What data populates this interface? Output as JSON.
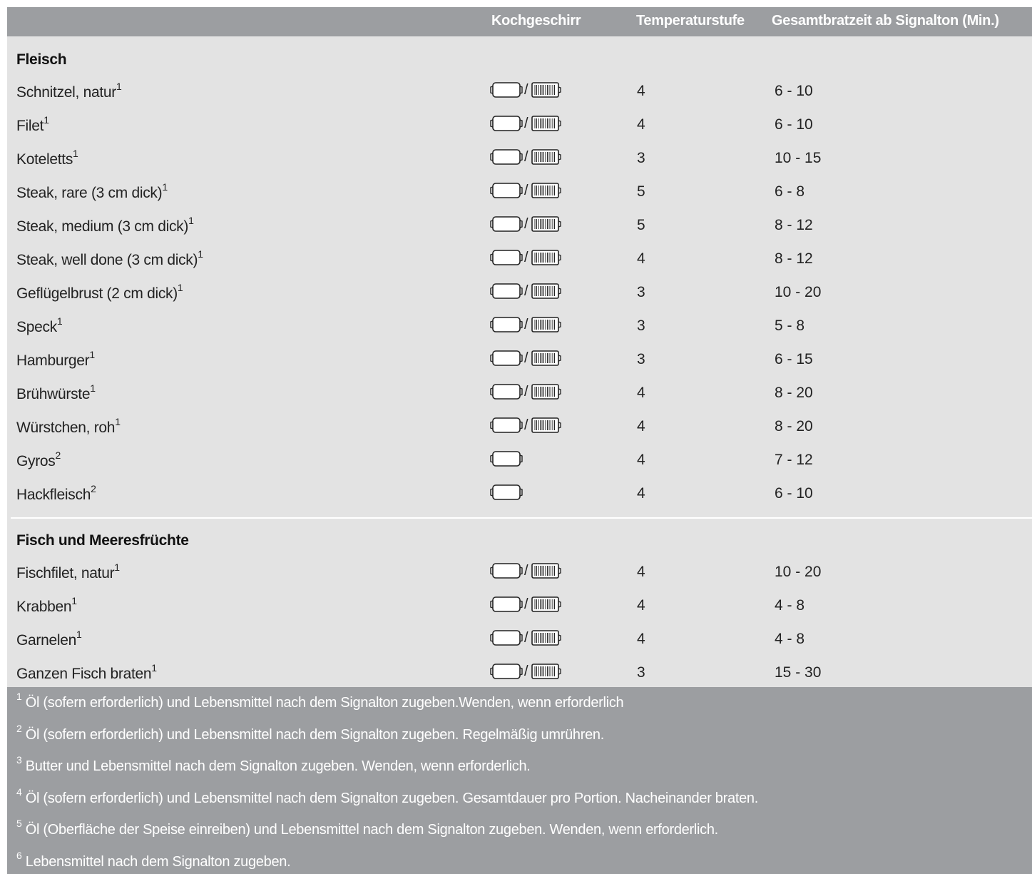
{
  "header": {
    "col_cookware": "Kochgeschirr",
    "col_temp": "Temperaturstufe",
    "col_time": "Gesamtbratzeit ab Signalton (Min.)"
  },
  "sections": [
    {
      "title": "Fleisch",
      "rows": [
        {
          "name": "Schnitzel, natur",
          "sup": "1",
          "cookware": [
            "pan-icon",
            "grill-plate-icon"
          ],
          "temp": "4",
          "time": "6 - 10"
        },
        {
          "name": "Filet",
          "sup": "1",
          "cookware": [
            "pan-icon",
            "grill-plate-icon"
          ],
          "temp": "4",
          "time": "6 - 10"
        },
        {
          "name": "Koteletts",
          "sup": "1",
          "cookware": [
            "pan-icon",
            "grill-plate-icon"
          ],
          "temp": "3",
          "time": "10 - 15"
        },
        {
          "name": "Steak, rare (3 cm dick)",
          "sup": "1",
          "cookware": [
            "pan-icon",
            "grill-plate-icon"
          ],
          "temp": "5",
          "time": "6 - 8"
        },
        {
          "name": "Steak, medium (3 cm dick)",
          "sup": "1",
          "cookware": [
            "pan-icon",
            "grill-plate-icon"
          ],
          "temp": "5",
          "time": "8 - 12"
        },
        {
          "name": "Steak, well done (3 cm dick)",
          "sup": "1",
          "cookware": [
            "pan-icon",
            "grill-plate-icon"
          ],
          "temp": "4",
          "time": "8 - 12"
        },
        {
          "name": "Geflügelbrust (2 cm dick)",
          "sup": "1",
          "cookware": [
            "pan-icon",
            "grill-plate-icon"
          ],
          "temp": "3",
          "time": "10 - 20"
        },
        {
          "name": "Speck",
          "sup": "1",
          "cookware": [
            "pan-icon",
            "grill-plate-icon"
          ],
          "temp": "3",
          "time": "5 - 8"
        },
        {
          "name": "Hamburger",
          "sup": "1",
          "cookware": [
            "pan-icon",
            "grill-plate-icon"
          ],
          "temp": "3",
          "time": "6 - 15"
        },
        {
          "name": "Brühwürste",
          "sup": "1",
          "cookware": [
            "pan-icon",
            "grill-plate-icon"
          ],
          "temp": "4",
          "time": "8 - 20"
        },
        {
          "name": "Würstchen, roh",
          "sup": "1",
          "cookware": [
            "pan-icon",
            "grill-plate-icon"
          ],
          "temp": "4",
          "time": "8 - 20"
        },
        {
          "name": "Gyros",
          "sup": "2",
          "cookware": [
            "pan-icon"
          ],
          "temp": "4",
          "time": "7 - 12"
        },
        {
          "name": "Hackfleisch",
          "sup": "2",
          "cookware": [
            "pan-icon"
          ],
          "temp": "4",
          "time": "6 - 10"
        }
      ]
    },
    {
      "title": "Fisch und Meeresfrüchte",
      "rows": [
        {
          "name": "Fischfilet, natur",
          "sup": "1",
          "cookware": [
            "pan-icon",
            "grill-plate-icon"
          ],
          "temp": "4",
          "time": "10 - 20"
        },
        {
          "name": "Krabben",
          "sup": "1",
          "cookware": [
            "pan-icon",
            "grill-plate-icon"
          ],
          "temp": "4",
          "time": "4 - 8"
        },
        {
          "name": "Garnelen",
          "sup": "1",
          "cookware": [
            "pan-icon",
            "grill-plate-icon"
          ],
          "temp": "4",
          "time": "4 - 8"
        },
        {
          "name": "Ganzen Fisch braten",
          "sup": "1",
          "cookware": [
            "pan-icon",
            "grill-plate-icon"
          ],
          "temp": "3",
          "time": "15 - 30"
        }
      ]
    }
  ],
  "separator": "/",
  "footnotes": [
    {
      "num": "1",
      "text": " Öl (sofern erforderlich) und Lebensmittel nach dem Signalton zugeben.Wenden, wenn erforderlich"
    },
    {
      "num": "2",
      "text": " Öl (sofern erforderlich) und Lebensmittel nach dem Signalton zugeben. Regelmäßig umrühren."
    },
    {
      "num": "3",
      "text": " Butter und Lebensmittel nach dem Signalton zugeben. Wenden, wenn erforderlich."
    },
    {
      "num": "4",
      "text": " Öl (sofern erforderlich) und Lebensmittel nach dem Signalton zugeben. Gesamtdauer pro Portion. Nacheinander braten."
    },
    {
      "num": "5",
      "text": " Öl (Oberfläche der Speise einreiben) und Lebensmittel nach dem Signalton zugeben. Wenden, wenn erforderlich."
    },
    {
      "num": "6",
      "text": " Lebensmittel nach dem Signalton zugeben."
    }
  ]
}
